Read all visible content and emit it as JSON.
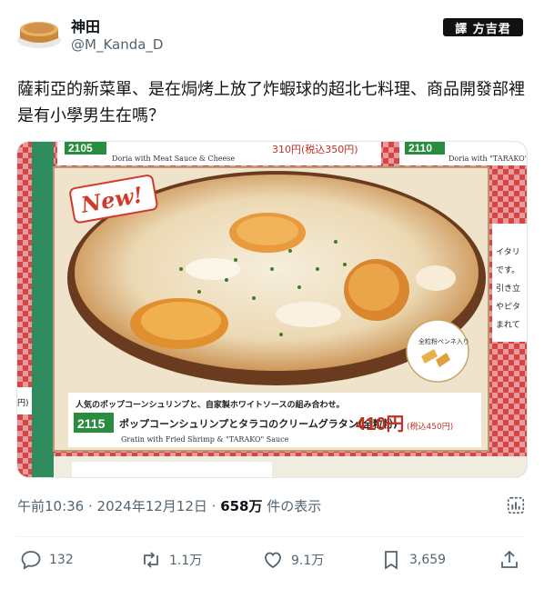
{
  "author": {
    "name": "神田",
    "handle": "@M_Kanda_D"
  },
  "badge": "譯 方吉君",
  "tweet": {
    "text": "薩莉亞的新菜單、是在焗烤上放了炸蝦球的超北七料理、商品開發部裡是有小學男生在嗎？"
  },
  "media": {
    "new_label": "New!",
    "top_left_code": "2105",
    "top_left_en": "Doria with Meat Sauce & Cheese",
    "top_left_price": "310円(税込350円)",
    "top_right_code": "2110",
    "top_right_en": "Doria with \"TARAKO\" Sau",
    "side_text": [
      "イタリ",
      "です。",
      "引き立",
      "やピタ",
      "まれて"
    ],
    "sticker_label": "全粒粉ペンネ入り",
    "desc": "人気のポップコーンシュリンプと、自家製ホワイトソースの組み合わせ。",
    "item_code": "2115",
    "item_name": "ポップコーンシュリンプとタラコのクリームグラタン(全粒粉)",
    "item_price": "410円",
    "item_tax": "(税込450円)",
    "item_en": "Gratin with Fried Shrimp & \"TARAKO\" Sauce",
    "left_edge_text": "円)"
  },
  "meta": {
    "time": "午前10:36 · 2024年12月12日 · ",
    "views": "658万",
    "views_suffix": " 件の表示"
  },
  "actions": {
    "replies": "132",
    "reposts": "1.1万",
    "likes": "9.1万",
    "bookmarks": "3,659"
  },
  "icons": [
    "cheesecake-avatar-icon",
    "analytics-icon",
    "reply-icon",
    "repost-icon",
    "like-icon",
    "bookmark-icon",
    "share-icon"
  ]
}
